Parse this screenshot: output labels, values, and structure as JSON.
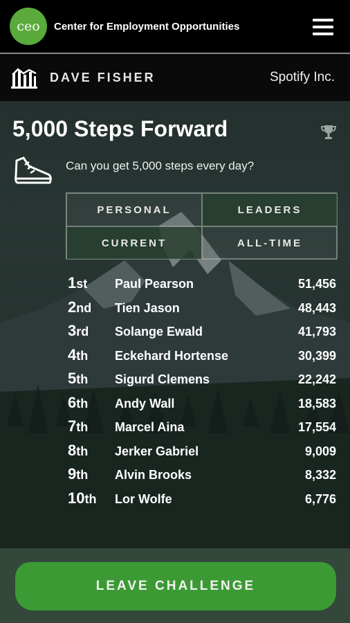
{
  "header": {
    "logo_text": "ceo",
    "org_name": "Center for Employment Opportunities",
    "menu_icon": "hamburger-menu-icon"
  },
  "user_bar": {
    "icon": "bar-chart-icon",
    "user_name": "DAVE FISHER",
    "company": "Spotify Inc."
  },
  "challenge": {
    "title": "5,000 Steps Forward",
    "trophy_icon": "trophy-icon",
    "shoe_icon": "sneaker-icon",
    "subtitle": "Can you get 5,000 steps every day?"
  },
  "tabs": [
    {
      "label": "PERSONAL",
      "active": false
    },
    {
      "label": "LEADERS",
      "active": true
    },
    {
      "label": "CURRENT",
      "active": true
    },
    {
      "label": "ALL-TIME",
      "active": false
    }
  ],
  "leaderboard": [
    {
      "num": "1",
      "suffix": "st",
      "name": "Paul Pearson",
      "score": "51,456"
    },
    {
      "num": "2",
      "suffix": "nd",
      "name": "Tien Jason",
      "score": "48,443"
    },
    {
      "num": "3",
      "suffix": "rd",
      "name": "Solange Ewald",
      "score": "41,793"
    },
    {
      "num": "4",
      "suffix": "th",
      "name": "Eckehard Hortense",
      "score": "30,399"
    },
    {
      "num": "5",
      "suffix": "th",
      "name": "Sigurd Clemens",
      "score": "22,242"
    },
    {
      "num": "6",
      "suffix": "th",
      "name": "Andy Wall",
      "score": "18,583"
    },
    {
      "num": "7",
      "suffix": "th",
      "name": "Marcel Aina",
      "score": "17,554"
    },
    {
      "num": "8",
      "suffix": "th",
      "name": "Jerker Gabriel",
      "score": "9,009"
    },
    {
      "num": "9",
      "suffix": "th",
      "name": "Alvin Brooks",
      "score": "8,332"
    },
    {
      "num": "10",
      "suffix": "th",
      "name": "Lor Wolfe",
      "score": "6,776"
    }
  ],
  "footer": {
    "leave_label": "LEAVE CHALLENGE"
  },
  "colors": {
    "accent_green": "#3c9a34",
    "logo_green": "#5aaa3c",
    "active_tab": "#284030"
  }
}
